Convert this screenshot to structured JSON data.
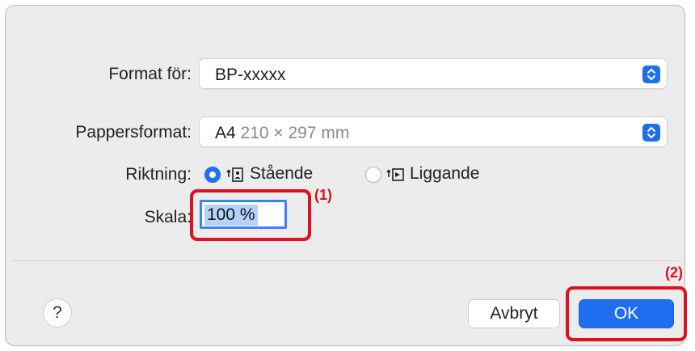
{
  "dialog": {
    "format_for": {
      "label": "Format för:",
      "value": "BP-xxxxx"
    },
    "paper_size": {
      "label": "Pappersformat:",
      "value_name": "A4",
      "value_dims": "210 × 297 mm"
    },
    "orientation": {
      "label": "Riktning:",
      "options": [
        {
          "label": "Stående",
          "selected": true
        },
        {
          "label": "Liggande",
          "selected": false
        }
      ]
    },
    "scale": {
      "label": "Skala:",
      "value": "100 %"
    },
    "help_label": "?",
    "cancel_label": "Avbryt",
    "ok_label": "OK"
  },
  "callouts": [
    "(1)",
    "(2)"
  ],
  "colors": {
    "accent": "#1f6ef0",
    "callout": "#e0101e",
    "dialog_bg": "#ececec"
  },
  "icons": {
    "popup_stepper": "up-down-chevron-icon",
    "portrait": "portrait-orientation-icon",
    "landscape": "landscape-orientation-icon"
  }
}
